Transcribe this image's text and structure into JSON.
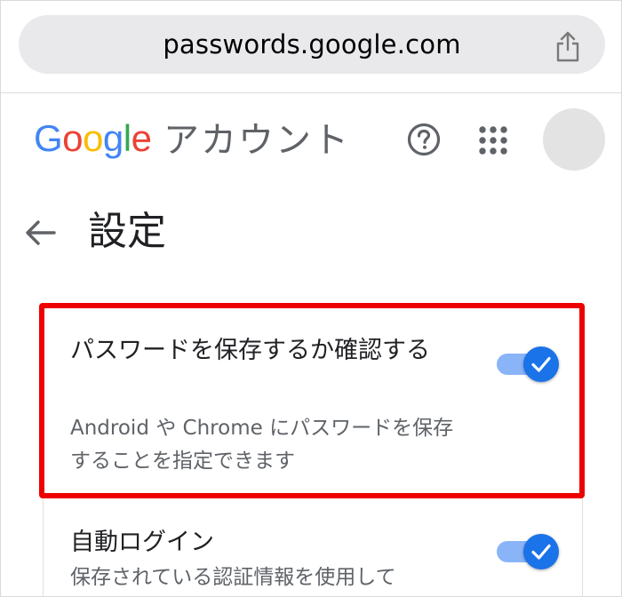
{
  "browser": {
    "url": "passwords.google.com",
    "share_icon": "share-icon"
  },
  "header": {
    "logo_letters": [
      "G",
      "o",
      "o",
      "g",
      "l",
      "e"
    ],
    "account_label": "アカウント",
    "help_icon": "help-circle-icon",
    "apps_icon": "apps-grid-icon"
  },
  "page": {
    "back_icon": "arrow-left-icon",
    "title": "設定"
  },
  "settings": [
    {
      "title": "パスワードを保存するか確認する",
      "description": "Android や Chrome にパスワードを保存することを指定できます",
      "enabled": true
    },
    {
      "title": "自動ログイン",
      "description": "保存されている認証情報を使用して",
      "enabled": true
    }
  ],
  "colors": {
    "google_blue": "#4285F4",
    "google_red": "#EA4335",
    "google_yellow": "#FBBC05",
    "google_green": "#34A853",
    "toggle_on": "#1a73e8",
    "toggle_track": "#8ab4f8",
    "highlight": "#ee0000"
  }
}
